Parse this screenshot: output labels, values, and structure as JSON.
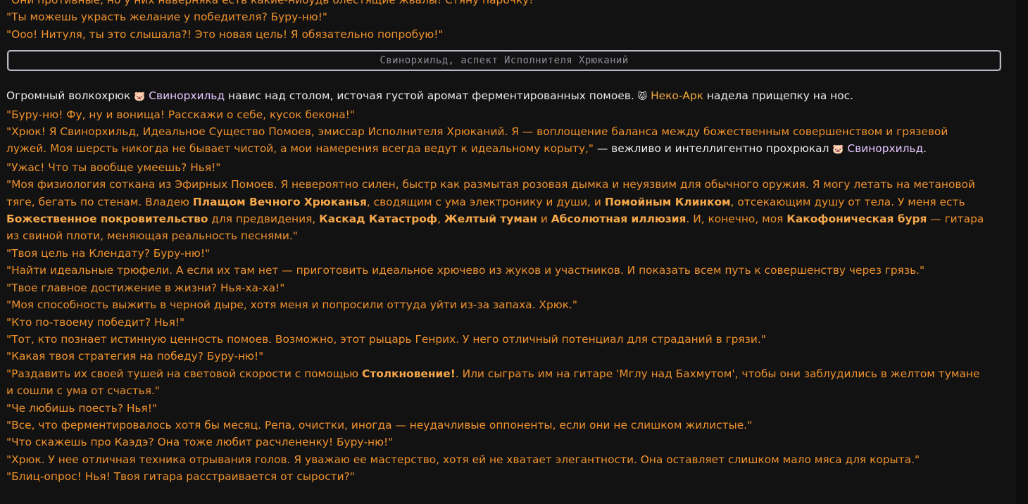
{
  "top_lines": [
    "\"Они противные, но у них наверняка есть какие-нибудь блестящие жвалы! Стяну парочку!\"",
    "\"Ты можешь украсть желание у победителя? Буру-ню!\"",
    "\"Ооо! Нитуля, ты это слышала?! Это новая цель! Я обязательно попробую!\""
  ],
  "separator": {
    "title": "Свинорхильд, аспект Исполнителя Хрюканий"
  },
  "intro": {
    "p1": "Огромный волкохрюк ",
    "pig_emoji": "🐷",
    "pig_name": "Свинорхильд",
    "p2": " навис над столом, источая густой аромат ферментированных помоев. ",
    "neko_emoji": "😾",
    "neko_name": "Неко-Арк",
    "p3": " надела прищепку на нос."
  },
  "q1": "\"Буру-ню! Фу, ну и вонища! Расскажи о себе, кусок бекона!\"",
  "a1": {
    "text": "\"Хрюк! Я Свинорхильд, Идеальное Существо Помоев, эмиссар Исполнителя Хрюканий. Я — воплощение баланса между божественным совершенством и грязевой лужей. Моя шерсть никогда не бывает чистой, а мои намерения всегда ведут к идеальному корыту,\"",
    "tail": " — вежливо и интеллигентно прохрюкал ",
    "pig_emoji": "🐷",
    "pig_name": "Свинорхильд",
    "end": "."
  },
  "q2": "\"Ужас! Что ты вообще умеешь? Нья!\"",
  "a2": {
    "s1": "\"Моя физиология соткана из Эфирных Помоев. Я невероятно силен, быстр как размытая розовая дымка и неуязвим для обычного оружия. Я могу летать на метановой тяге, бегать по стенам. Владею ",
    "b1": "Плащом Вечного Хрюканья",
    "s2": ", сводящим с ума электронику и души, и ",
    "b2": "Помойным Клинком",
    "s3": ", отсекающим душу от тела. У меня есть ",
    "b3": "Божественное покровительство",
    "s4": " для предвидения, ",
    "b4": "Каскад Катастроф",
    "s5": ", ",
    "b5": "Желтый туман",
    "s6": " и ",
    "b6": "Абсолютная иллюзия",
    "s7": ". И, конечно, моя ",
    "b7": "Какофоническая буря",
    "s8": " — гитара из свиной плоти, меняющая реальность песнями.\""
  },
  "q3": "\"Твоя цель на Клендату? Буру-ню!\"",
  "a3": "\"Найти идеальные трюфели. А если их там нет — приготовить идеальное хрючево из жуков и участников. И показать всем путь к совершенству через грязь.\"",
  "q4": "\"Твое главное достижение в жизни? Нья-ха-ха!\"",
  "a4": "\"Моя способность выжить в черной дыре, хотя меня и попросили оттуда уйти из-за запаха. Хрюк.\"",
  "q5": "\"Кто по-твоему победит? Нья!\"",
  "a5": "\"Тот, кто познает истинную ценность помоев. Возможно, этот рыцарь Генрих. У него отличный потенциал для страданий в грязи.\"",
  "q6": "\"Какая твоя стратегия на победу? Буру-ню!\"",
  "a6": {
    "s1": "\"Раздавить их своей тушей на световой скорости с помощью ",
    "b1": "Столкновение!",
    "s2": ". Или сыграть им на гитаре 'Мглу над Бахмутом', чтобы они заблудились в желтом тумане и сошли с ума от счастья.\""
  },
  "q7": "\"Че любишь поесть? Нья!\"",
  "a7": "\"Все, что ферментировалось хотя бы месяц. Репа, очистки, иногда — неудачливые оппоненты, если они не слишком жилистые.\"",
  "q8": "\"Что скажешь про Каэдэ? Она тоже любит расчлененку! Буру-ню!\"",
  "a8": "\"Хрюк. У нее отличная техника отрывания голов. Я уважаю ее мастерство, хотя ей не хватает элегантности. Она оставляет слишком мало мяса для корыта.\"",
  "q9": "\"Блиц-опрос! Нья! Твоя гитара расстраивается от сырости?\""
}
